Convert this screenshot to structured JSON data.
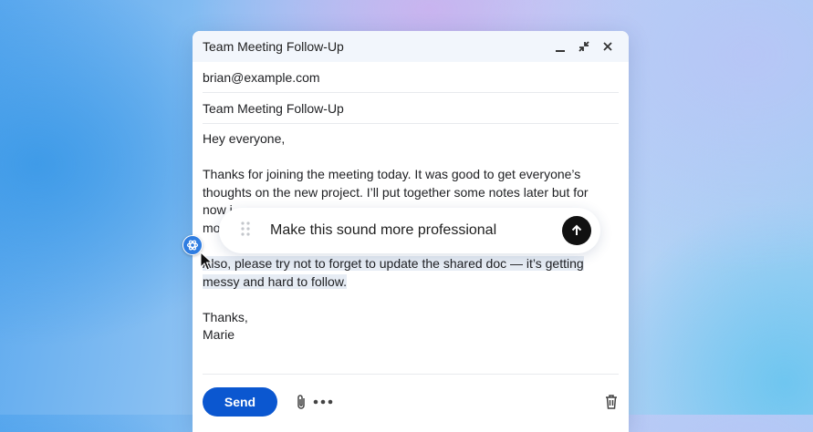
{
  "window": {
    "title": "Team Meeting Follow-Up"
  },
  "fields": {
    "to": "brian@example.com",
    "subject": "Team Meeting Follow-Up"
  },
  "body": {
    "greeting": "Hey everyone,",
    "p1_visible": "Thanks for joining the meeting today. It was good to get everyone’s thoughts on the new project. I’ll put together some notes later but for",
    "p1_line3_start": "now i",
    "p1_line4_start": "mo",
    "p2": "Also, please try not to forget to update the shared doc — it’s getting messy and hard to follow.",
    "signoff": "Thanks,",
    "signature": "Marie"
  },
  "prompt": {
    "text": "Make this sound more professional"
  },
  "footer": {
    "send_label": "Send"
  },
  "colors": {
    "accent": "#0b57d0",
    "highlight": "#e6ecf4",
    "ai_badge": "#2f7de1"
  },
  "icons": [
    "minimize-icon",
    "exit-fullscreen-icon",
    "close-icon",
    "drag-handle-icon",
    "send-arrow-icon",
    "attach-icon",
    "more-options-icon",
    "trash-icon",
    "ai-assistant-icon",
    "mouse-cursor-icon"
  ]
}
